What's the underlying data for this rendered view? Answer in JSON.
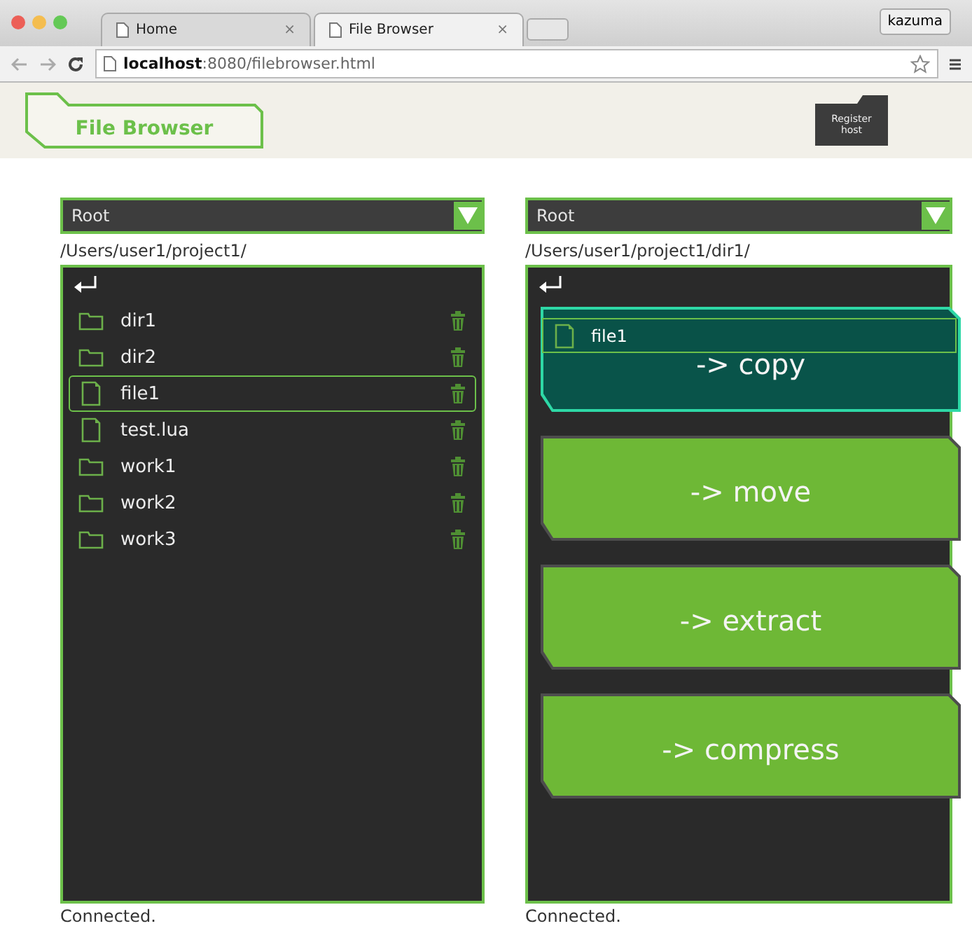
{
  "browser": {
    "tabs": [
      {
        "title": "Home",
        "close": "×",
        "selected": false
      },
      {
        "title": "File Browser",
        "close": "×",
        "selected": true
      }
    ],
    "user": "kazuma",
    "url": "**localhost**:8080/filebrowser.html"
  },
  "header": {
    "title": "File Browser",
    "register_button": "Register host"
  },
  "panels": [
    {
      "dropdown": "Root",
      "path": "/Users/user1/project1/",
      "items": [
        {
          "name": "dir1",
          "kind": "folder",
          "selected": false
        },
        {
          "name": "dir2",
          "kind": "folder",
          "selected": false
        },
        {
          "name": "file1",
          "kind": "file",
          "selected": true
        },
        {
          "name": "test.lua",
          "kind": "file",
          "selected": false
        },
        {
          "name": "work1",
          "kind": "folder",
          "selected": false
        },
        {
          "name": "work2",
          "kind": "folder",
          "selected": false
        },
        {
          "name": "work3",
          "kind": "folder",
          "selected": false
        }
      ],
      "status": "Connected."
    },
    {
      "dropdown": "Root",
      "path": "/Users/user1/project1/dir1/",
      "dragged_item": "file1",
      "actions": [
        {
          "label": "-> copy",
          "selected": true
        },
        {
          "label": "-> move",
          "selected": false
        },
        {
          "label": "-> extract",
          "selected": false
        },
        {
          "label": "-> compress",
          "selected": false
        }
      ],
      "status": "Connected."
    }
  ]
}
